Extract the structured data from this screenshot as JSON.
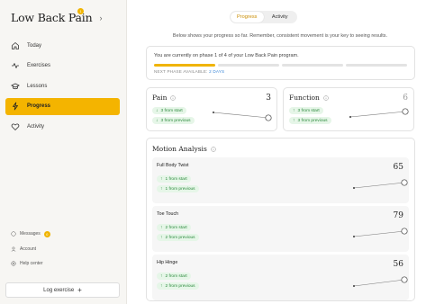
{
  "app": {
    "title": "Low Back Pain",
    "badge": "1"
  },
  "sidebar": {
    "items": [
      {
        "label": "Today",
        "icon": "home-icon"
      },
      {
        "label": "Exercises",
        "icon": "activity-icon"
      },
      {
        "label": "Lessons",
        "icon": "graduation-cap-icon"
      },
      {
        "label": "Progress",
        "icon": "bolt-icon",
        "active": true
      },
      {
        "label": "Activity",
        "icon": "heart-icon"
      }
    ],
    "lower": {
      "messages": "Messages",
      "messages_badge": "0",
      "account": "Account",
      "help": "Help center"
    },
    "log_label": "Log exercise"
  },
  "toggle": {
    "progress": "Progress",
    "activity": "Activity"
  },
  "intro": "Below shows your progress so far.  Remember, consistent movement is your key to seeing results.",
  "phase": {
    "text": "You are currently on phase 1 of 4 of your Low Back Pain program.",
    "current": 1,
    "total": 4,
    "next_label": "NEXT PHASE AVAILABLE:",
    "next_days": "2 DAYS"
  },
  "pain": {
    "title": "Pain",
    "value": "3",
    "start": "3 from start",
    "previous": "3 from previous"
  },
  "function": {
    "title": "Function",
    "value": "6",
    "start": "3 from start",
    "previous": "3 from previous"
  },
  "motion": {
    "title": "Motion Analysis",
    "exercises": [
      {
        "name": "Full Body Twist",
        "value": "65",
        "start": "1 from start",
        "previous": "1 from previous"
      },
      {
        "name": "Toe Touch",
        "value": "79",
        "start": "2 from start",
        "previous": "2 from previous"
      },
      {
        "name": "Hip Hinge",
        "value": "56",
        "start": "2 from start",
        "previous": "2 from previous"
      }
    ]
  },
  "colors": {
    "accent": "#f4b400",
    "good": "#2d8a3e",
    "good_bg": "#e6f6e8",
    "link": "#3a86d8"
  }
}
